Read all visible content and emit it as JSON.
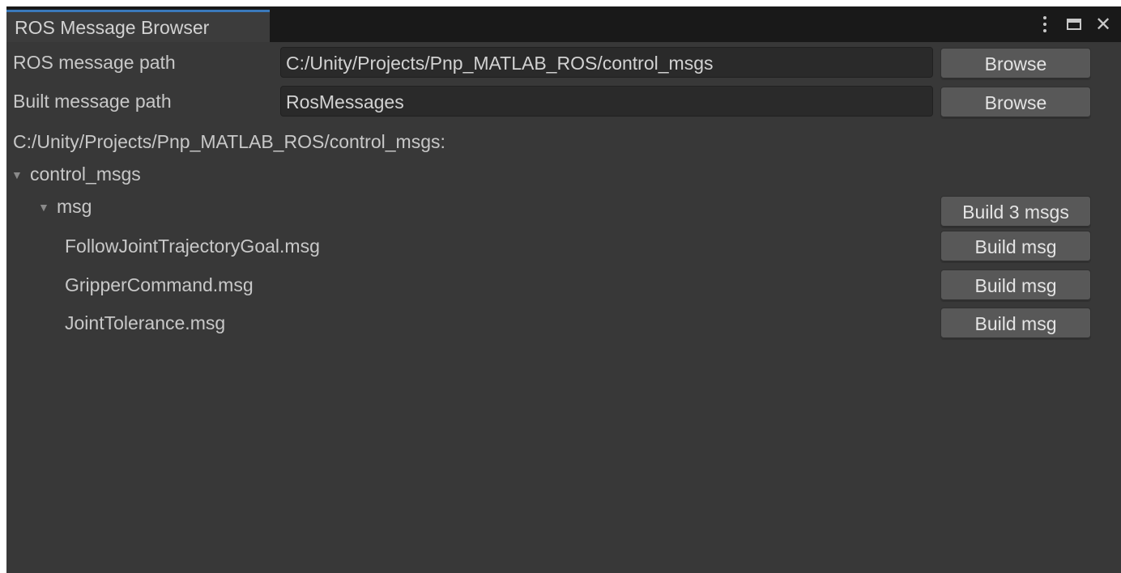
{
  "window": {
    "tab_title": "ROS Message Browser",
    "controls": [
      "more-options-icon",
      "maximize-icon",
      "close-icon"
    ],
    "close_glyph": "✕"
  },
  "settings": {
    "ros_path_label": "ROS message path",
    "ros_path_value": "C:/Unity/Projects/Pnp_MATLAB_ROS/control_msgs",
    "ros_path_button": "Browse",
    "built_path_label": "Built message path",
    "built_path_value": "RosMessages",
    "built_path_button": "Browse"
  },
  "tree": {
    "root_path": "C:/Unity/Projects/Pnp_MATLAB_ROS/control_msgs:",
    "package": {
      "name": "control_msgs",
      "expanded": true,
      "folder": {
        "name": "msg",
        "expanded": true,
        "build_all_label": "Build 3 msgs",
        "files": [
          {
            "name": "FollowJointTrajectoryGoal.msg",
            "button": "Build msg"
          },
          {
            "name": "GripperCommand.msg",
            "button": "Build msg"
          },
          {
            "name": "JointTolerance.msg",
            "button": "Build msg"
          }
        ]
      }
    }
  },
  "colors": {
    "background": "#383838",
    "tabbar": "#191919",
    "tab_accent": "#3a79bb",
    "button": "#585858",
    "field": "#2a2a2a"
  }
}
